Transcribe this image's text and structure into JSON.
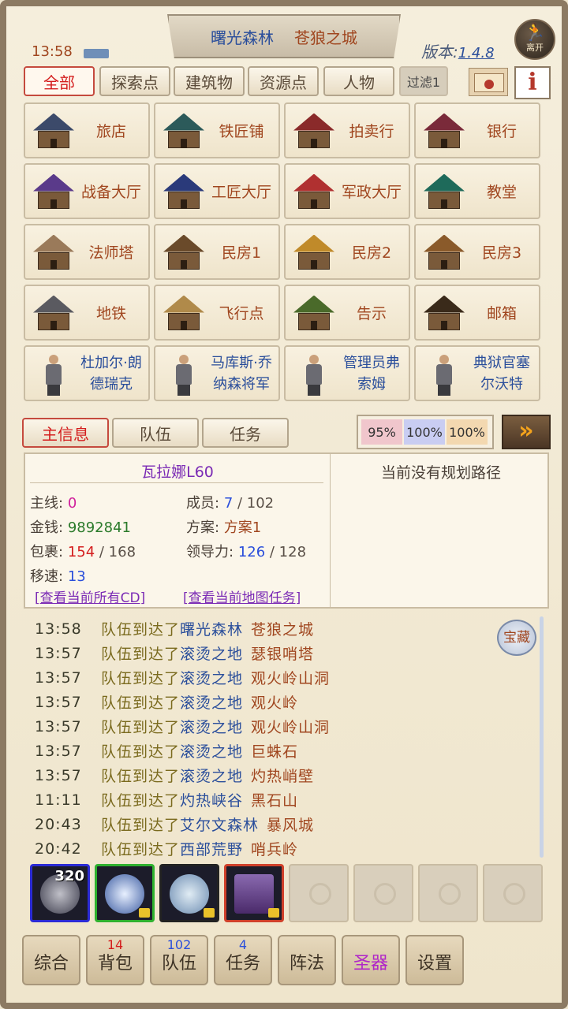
{
  "status": {
    "time": "13:58"
  },
  "header": {
    "zone": "曙光森林",
    "place": "苍狼之城",
    "version_label": "版本:",
    "version_number": "1.4.8",
    "leave_label": "离开"
  },
  "filters": {
    "tabs": [
      "全部",
      "探索点",
      "建筑物",
      "资源点",
      "人物"
    ],
    "filter_label": "过滤1",
    "info_label": "i"
  },
  "locations": [
    {
      "label": "旅店",
      "kind": "building",
      "roof": "#3c4a6a"
    },
    {
      "label": "铁匠铺",
      "kind": "building",
      "roof": "#2c5a5a"
    },
    {
      "label": "拍卖行",
      "kind": "building",
      "roof": "#8a2a2a"
    },
    {
      "label": "银行",
      "kind": "building",
      "roof": "#7a2a3a"
    },
    {
      "label": "战备大厅",
      "kind": "building",
      "roof": "#5a3a8a"
    },
    {
      "label": "工匠大厅",
      "kind": "building",
      "roof": "#2a3a7a"
    },
    {
      "label": "军政大厅",
      "kind": "building",
      "roof": "#b03030"
    },
    {
      "label": "教堂",
      "kind": "building",
      "roof": "#1e6a5a"
    },
    {
      "label": "法师塔",
      "kind": "building",
      "roof": "#9a7a5a"
    },
    {
      "label": "民房1",
      "kind": "building",
      "roof": "#6a4a2a"
    },
    {
      "label": "民房2",
      "kind": "building",
      "roof": "#c08a2a"
    },
    {
      "label": "民房3",
      "kind": "building",
      "roof": "#8a5a2a"
    },
    {
      "label": "地铁",
      "kind": "building",
      "roof": "#5a5a60"
    },
    {
      "label": "飞行点",
      "kind": "building",
      "roof": "#b08a4a"
    },
    {
      "label": "告示",
      "kind": "building",
      "roof": "#4a6a2a"
    },
    {
      "label": "邮箱",
      "kind": "building",
      "roof": "#3a2a1a"
    },
    {
      "label": "杜加尔·朗德瑞克",
      "kind": "npc",
      "line1": "杜加尔·朗",
      "line2": "德瑞克"
    },
    {
      "label": "马库斯·乔纳森将军",
      "kind": "npc",
      "line1": "马库斯·乔",
      "line2": "纳森将军"
    },
    {
      "label": "管理员弗索姆",
      "kind": "npc",
      "line1": "管理员弗",
      "line2": "索姆"
    },
    {
      "label": "典狱官塞尔沃特",
      "kind": "npc",
      "line1": "典狱官塞",
      "line2": "尔沃特"
    }
  ],
  "info_tabs": [
    "主信息",
    "队伍",
    "任务"
  ],
  "speeds": [
    "95%",
    "100%",
    "100%"
  ],
  "next_label": "»",
  "character": {
    "name": "瓦拉娜L60",
    "route": "当前没有规划路径",
    "main_line_label": "主线:",
    "main_line": "0",
    "money_label": "金钱:",
    "money": "9892841",
    "bag_label": "包裹:",
    "bag_used": "154",
    "bag_max": " / 168",
    "speed_label": "移速:",
    "speed": "13",
    "members_label": "成员:",
    "members": "7",
    "members_max": " / 102",
    "plan_label": "方案:",
    "plan": "方案1",
    "leadership_label": "领导力:",
    "leadership": "126",
    "leadership_max": " / 128",
    "link_cd": "[查看当前所有CD]",
    "link_tasks": "[查看当前地图任务]"
  },
  "log": [
    {
      "time": "13:58",
      "msg": "队伍到达了",
      "zone": "曙光森林",
      "place": "苍狼之城"
    },
    {
      "time": "13:57",
      "msg": "队伍到达了",
      "zone": "滚烫之地",
      "place": "瑟银哨塔"
    },
    {
      "time": "13:57",
      "msg": "队伍到达了",
      "zone": "滚烫之地",
      "place": "观火岭山洞"
    },
    {
      "time": "13:57",
      "msg": "队伍到达了",
      "zone": "滚烫之地",
      "place": "观火岭"
    },
    {
      "time": "13:57",
      "msg": "队伍到达了",
      "zone": "滚烫之地",
      "place": "观火岭山洞"
    },
    {
      "time": "13:57",
      "msg": "队伍到达了",
      "zone": "滚烫之地",
      "place": "巨蛛石"
    },
    {
      "time": "13:57",
      "msg": "队伍到达了",
      "zone": "滚烫之地",
      "place": "灼热峭壁"
    },
    {
      "time": "11:11",
      "msg": "队伍到达了",
      "zone": "灼热峡谷",
      "place": "黑石山"
    },
    {
      "time": "20:43",
      "msg": "队伍到达了",
      "zone": "艾尔文森林",
      "place": "暴风城"
    },
    {
      "time": "20:42",
      "msg": "队伍到达了",
      "zone": "西部荒野",
      "place": "哨兵岭"
    }
  ],
  "treasure_label": "宝藏",
  "items": [
    {
      "name": "skull-item",
      "count": "320",
      "border": "blue"
    },
    {
      "name": "crystal-item",
      "count": "",
      "border": "green"
    },
    {
      "name": "whirl-stone-item",
      "count": "",
      "border": "black"
    },
    {
      "name": "purple-chest-item",
      "count": "",
      "border": "red"
    }
  ],
  "nav": [
    {
      "label": "综合",
      "badge": ""
    },
    {
      "label": "背包",
      "badge": "14",
      "badge_color": "red"
    },
    {
      "label": "队伍",
      "badge": "102",
      "badge_color": "blue"
    },
    {
      "label": "任务",
      "badge": "4",
      "badge_color": "blue"
    },
    {
      "label": "阵法",
      "badge": ""
    },
    {
      "label": "圣器",
      "badge": "",
      "highlight": true
    },
    {
      "label": "设置",
      "badge": ""
    }
  ]
}
